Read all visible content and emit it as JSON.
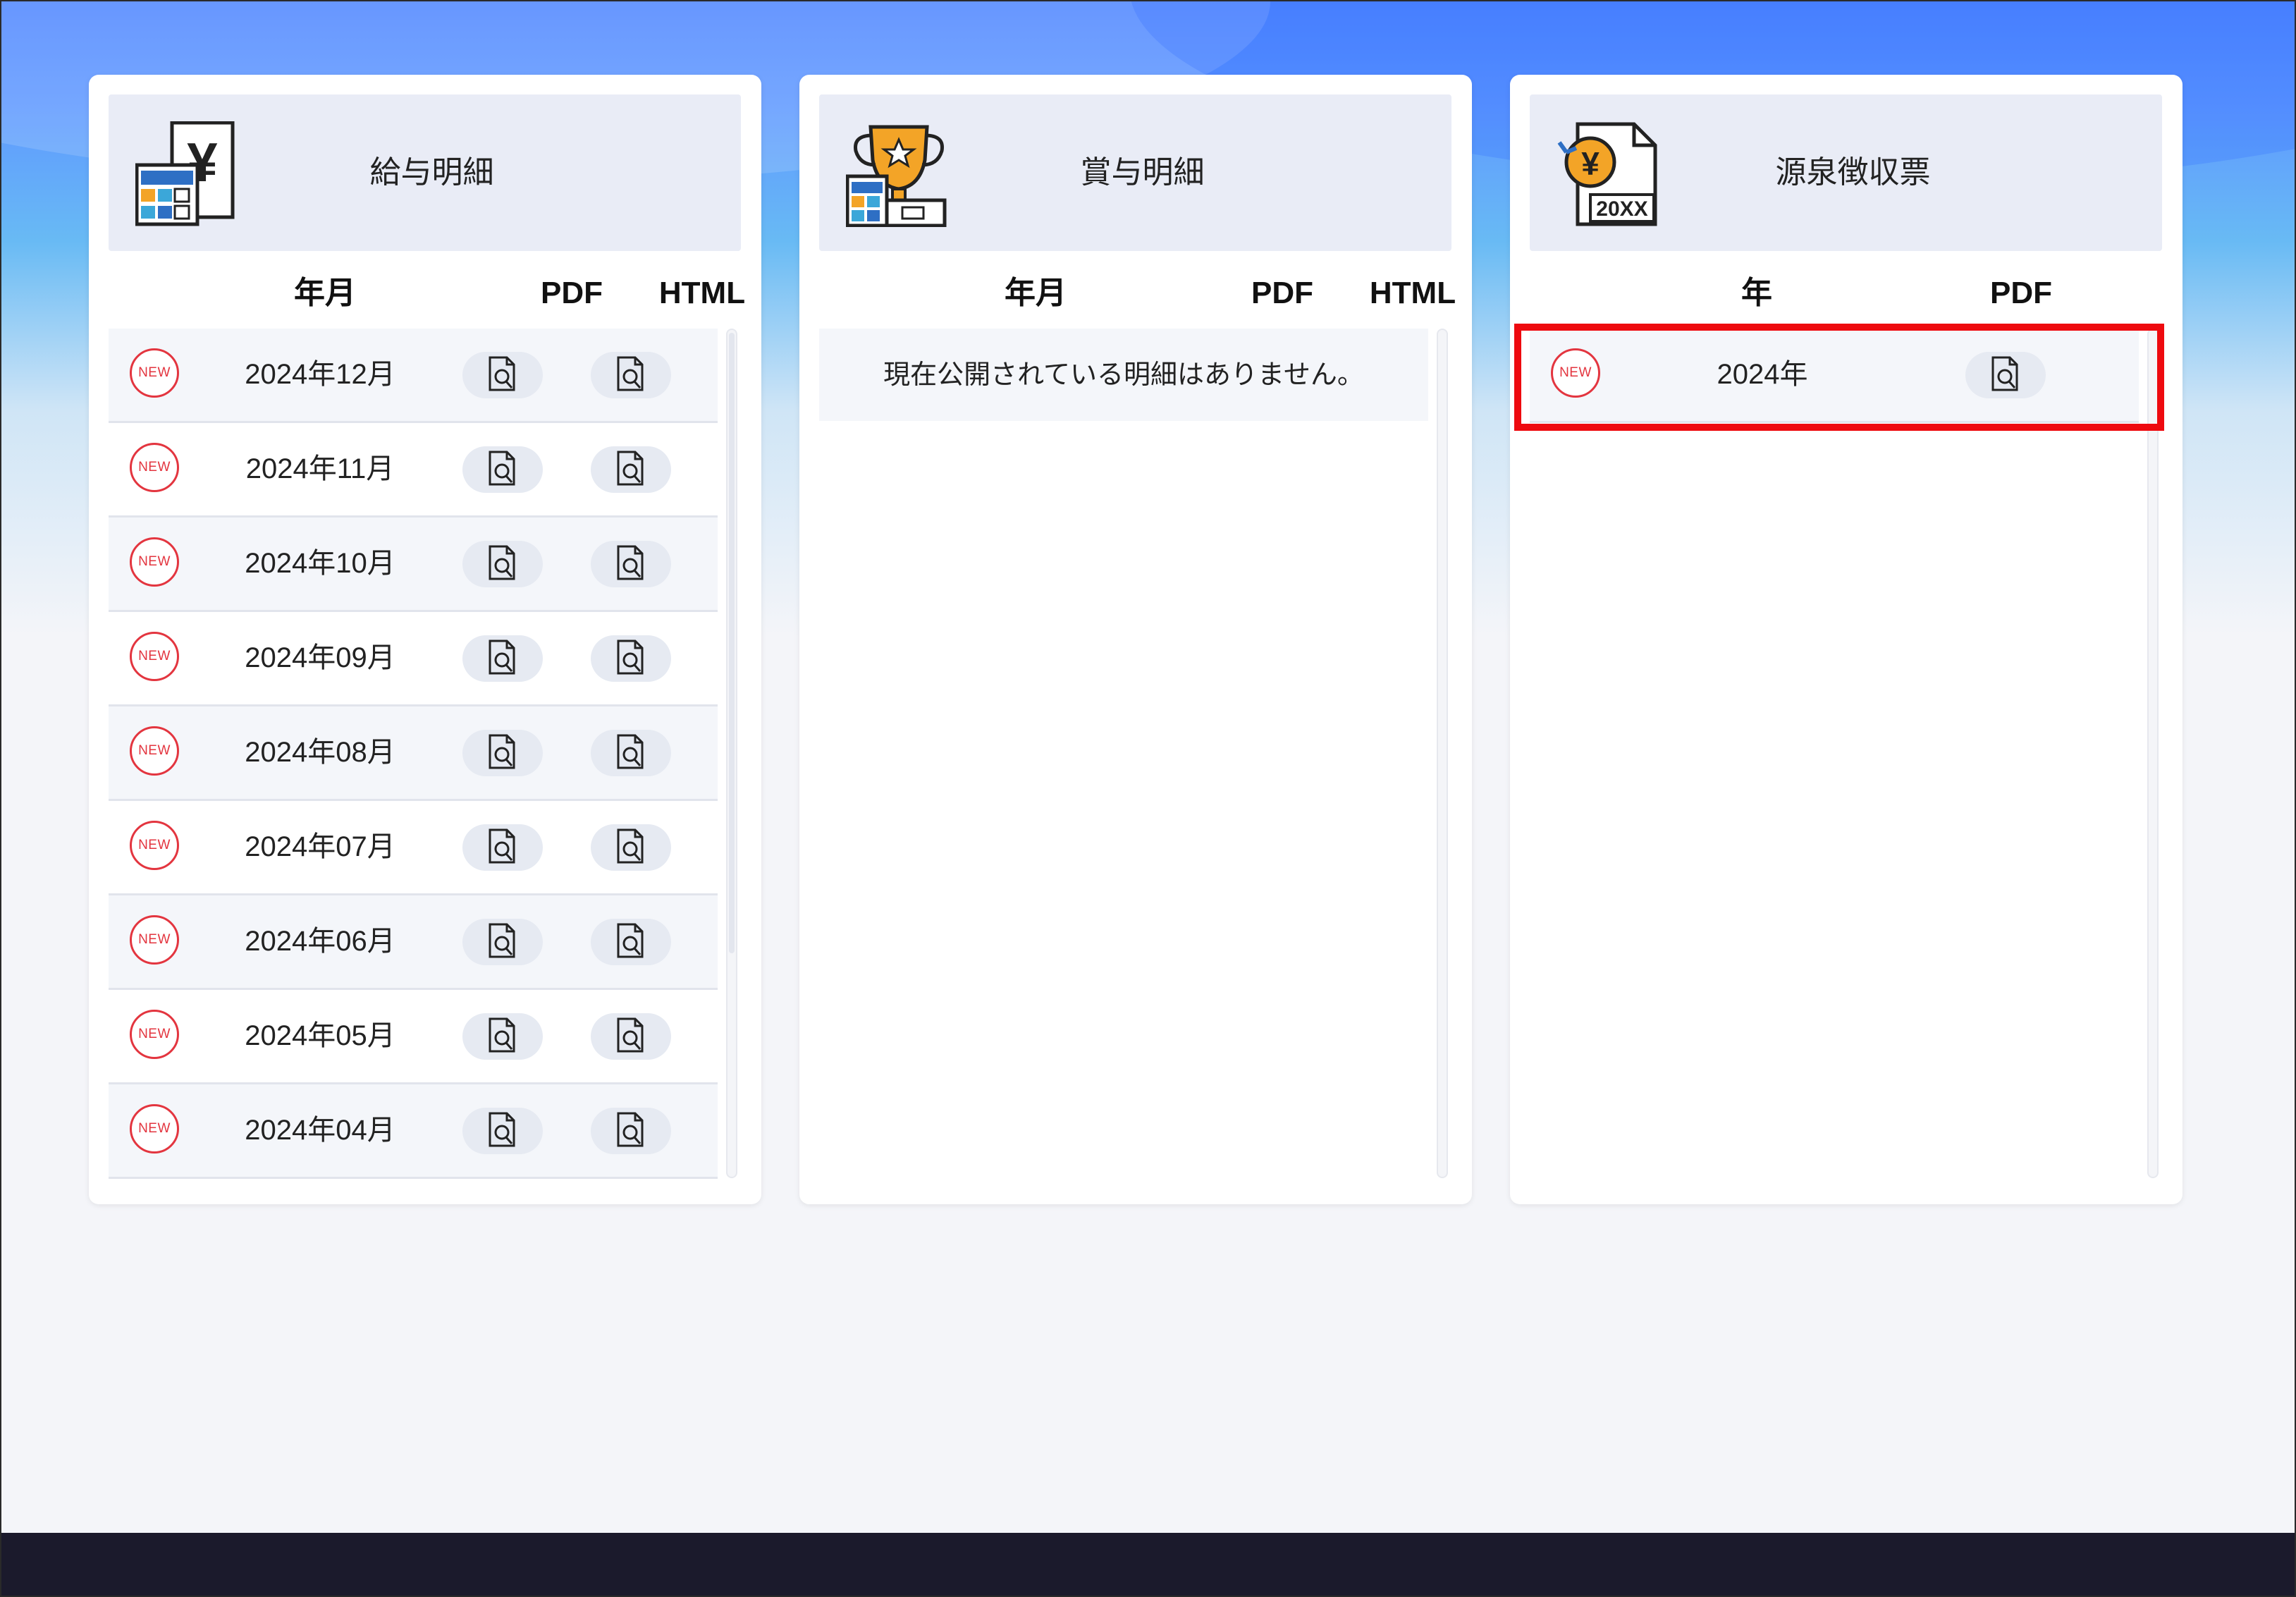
{
  "salary": {
    "title": "給与明細",
    "col_period": "年月",
    "col_pdf": "PDF",
    "col_html": "HTML",
    "badge": "NEW",
    "rows": [
      "2024年12月",
      "2024年11月",
      "2024年10月",
      "2024年09月",
      "2024年08月",
      "2024年07月",
      "2024年06月",
      "2024年05月",
      "2024年04月"
    ]
  },
  "bonus": {
    "title": "賞与明細",
    "col_period": "年月",
    "col_pdf": "PDF",
    "col_html": "HTML",
    "empty_message": "現在公開されている明細はありません。"
  },
  "withholding": {
    "title": "源泉徴収票",
    "col_year": "年",
    "col_pdf": "PDF",
    "badge": "NEW",
    "rows": [
      "2024年"
    ],
    "icon_text": "20XX",
    "highlight_color": "#ee0a0f"
  },
  "icons": {
    "salary": "salary-calculator-yen-icon",
    "bonus": "bonus-trophy-icon",
    "withholding": "tax-document-yen-icon",
    "view": "document-magnifier-icon"
  }
}
